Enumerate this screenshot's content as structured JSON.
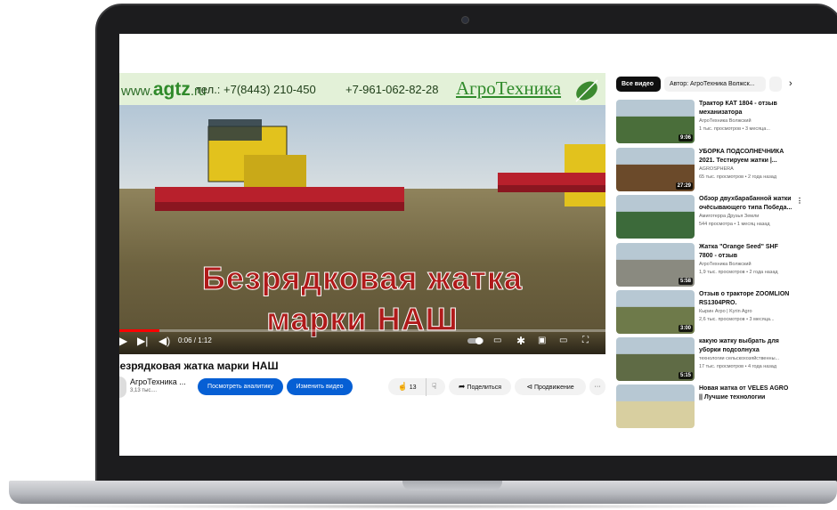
{
  "video": {
    "banner_url_brand": "agtz",
    "banner_url_prefix": "www.",
    "banner_url_suffix": ".ru",
    "banner_phone1": "тел.: +7(8443) 210-450",
    "banner_phone2": "+7-961-062-82-28",
    "banner_brand": "АгроТехника",
    "overlay_line1": "Безрядковая жатка",
    "overlay_line2": "марки НАШ",
    "time": "0:06 / 1:12",
    "progress_fraction": 0.083,
    "title": "Безрядковая жатка марки НАШ"
  },
  "channel": {
    "name": "АгроТехника ...",
    "subscribers": "3,13 тыс...."
  },
  "actions": {
    "analytics": "Посмотреть аналитику",
    "edit": "Изменить видео",
    "likes": "13",
    "share": "Поделиться",
    "promote": "Продвижение",
    "more": "···"
  },
  "sidebar": {
    "chips": [
      "Все видео",
      "Автор: АгроТехника Волжск..."
    ],
    "recommendations": [
      {
        "title": "Трактор КАТ 1804 - отзыв механизатора",
        "channel": "АгроТехника Волжский",
        "meta": "1 тыс. просмотров • 3 месяца...",
        "duration": "9:06",
        "thumb_color": "#4a6e3a"
      },
      {
        "title": "УБОРКА ПОДСОЛНЕЧНИКА 2021. Тестируем жатки |...",
        "channel": "AGROSPHERA",
        "meta": "65 тыс. просмотров • 2 года назад",
        "duration": "27:29",
        "thumb_color": "#6b4a2a"
      },
      {
        "title": "Обзор двухбарабанной жатки очёсывающего типа Победа...",
        "channel": "Амиготерра Друзья Земли",
        "meta": "544 просмотра • 1 месяц назад",
        "duration": "",
        "thumb_color": "#3c6a3a"
      },
      {
        "title": "Жатка \"Orange Seed\" SHF 7800 - отзыв",
        "channel": "АгроТехника Волжский",
        "meta": "1,9 тыс. просмотров • 2 года назад",
        "duration": "5:58",
        "thumb_color": "#8a8a80"
      },
      {
        "title": "Отзыв о тракторе ZOOMLION RS1304PRO.",
        "channel": "Кырин Агро | Kyrin Agro",
        "meta": "2,6 тыс. просмотров • 3 месяца...",
        "duration": "3:00",
        "thumb_color": "#6e7a4a"
      },
      {
        "title": "какую жатку выбрать для уборки подсолнуха",
        "channel": "технологии сельскохозяйственны...",
        "meta": "17 тыс. просмотров • 4 года назад",
        "duration": "5:15",
        "thumb_color": "#5f6b45"
      },
      {
        "title": "Новая жатка от VELES AGRO || Лучшие технологии лучший...",
        "channel": "",
        "meta": "",
        "duration": "",
        "thumb_color": "#d8cfa0"
      }
    ]
  }
}
